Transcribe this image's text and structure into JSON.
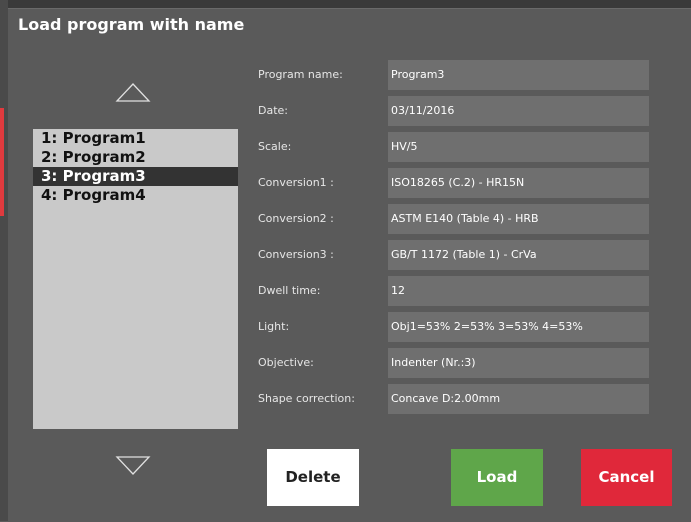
{
  "dialog": {
    "title": "Load program with name"
  },
  "programs": [
    {
      "label": "1: Program1",
      "selected": false
    },
    {
      "label": "2: Program2",
      "selected": false
    },
    {
      "label": "3: Program3",
      "selected": true
    },
    {
      "label": "4: Program4",
      "selected": false
    }
  ],
  "details": [
    {
      "label": "Program name:",
      "value": "Program3"
    },
    {
      "label": "Date:",
      "value": "03/11/2016"
    },
    {
      "label": "Scale:",
      "value": "HV/5"
    },
    {
      "label": "Conversion1 :",
      "value": "ISO18265 (C.2) - HR15N"
    },
    {
      "label": "Conversion2 :",
      "value": "ASTM E140 (Table 4) - HRB"
    },
    {
      "label": "Conversion3 :",
      "value": "GB/T 1172 (Table 1) - CrVa"
    },
    {
      "label": "Dwell time:",
      "value": "12"
    },
    {
      "label": "Light:",
      "value": "Obj1=53% 2=53% 3=53% 4=53%"
    },
    {
      "label": "Objective:",
      "value": "Indenter (Nr.:3)"
    },
    {
      "label": "Shape correction:",
      "value": "Concave D:2.00mm"
    }
  ],
  "buttons": {
    "delete": "Delete",
    "load": "Load",
    "cancel": "Cancel"
  },
  "icons": {
    "scroll_up": "arrow-up-icon",
    "scroll_down": "arrow-down-icon"
  },
  "colors": {
    "load": "#5fa64a",
    "cancel": "#e0283a",
    "selected_row": "#333333"
  }
}
